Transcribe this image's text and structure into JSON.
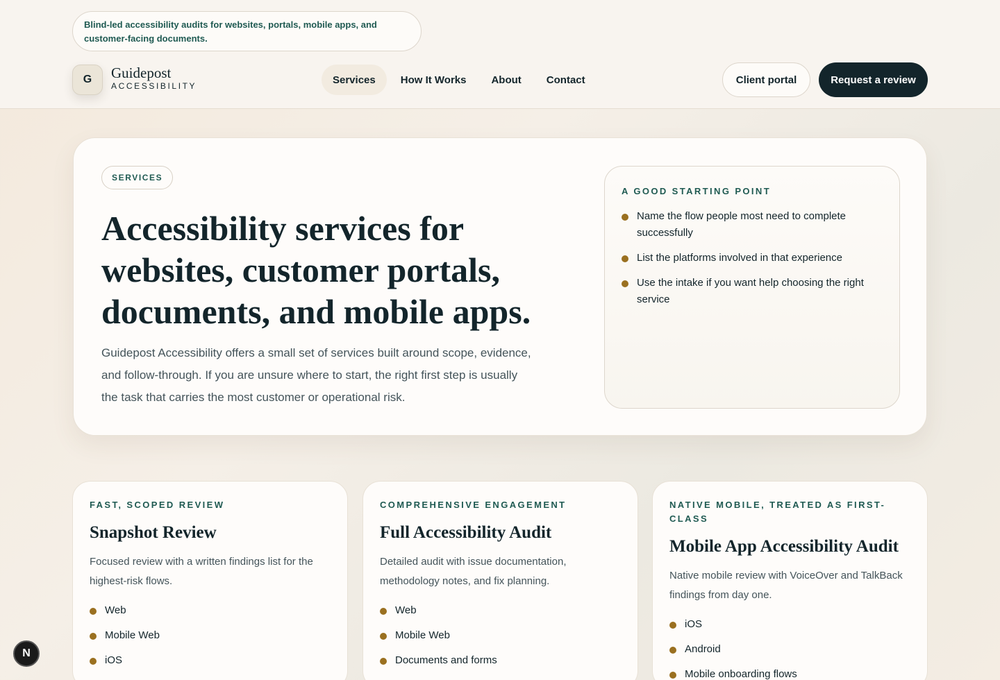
{
  "header": {
    "tagline": "Blind-led accessibility audits for websites, portals, mobile apps, and customer-facing documents.",
    "logo_letter": "G",
    "brand_name": "Guidepost",
    "brand_sub": "ACCESSIBILITY",
    "nav": [
      {
        "label": "Services",
        "active": true
      },
      {
        "label": "How It Works"
      },
      {
        "label": "About"
      },
      {
        "label": "Contact"
      }
    ],
    "client_portal": "Client portal",
    "request_review": "Request a review"
  },
  "hero": {
    "badge": "SERVICES",
    "title": "Accessibility services for websites, customer portals, documents, and mobile apps.",
    "text": "Guidepost Accessibility offers a small set of services built around scope, evidence, and follow-through. If you are unsure where to start, the right first step is usually the task that carries the most customer or operational risk.",
    "start_card": {
      "kicker": "A GOOD STARTING POINT",
      "items": [
        "Name the flow people most need to complete successfully",
        "List the platforms involved in that experience",
        "Use the intake if you want help choosing the right service"
      ]
    }
  },
  "services": [
    {
      "kicker": "FAST, SCOPED REVIEW",
      "title": "Snapshot Review",
      "desc": "Focused review with a written findings list for the highest-risk flows.",
      "items": [
        "Web",
        "Mobile Web",
        "iOS"
      ]
    },
    {
      "kicker": "COMPREHENSIVE ENGAGEMENT",
      "title": "Full Accessibility Audit",
      "desc": "Detailed audit with issue documentation, methodology notes, and fix planning.",
      "items": [
        "Web",
        "Mobile Web",
        "Documents and forms"
      ]
    },
    {
      "kicker": "NATIVE MOBILE, TREATED AS FIRST-CLASS",
      "title": "Mobile App Accessibility Audit",
      "desc": "Native mobile review with VoiceOver and TalkBack findings from day one.",
      "items": [
        "iOS",
        "Android",
        "Mobile onboarding flows"
      ]
    }
  ],
  "fab_label": "N",
  "colors": {
    "accent": "#1f5a52",
    "dark": "#13252b",
    "bullet": "#9a7020"
  }
}
